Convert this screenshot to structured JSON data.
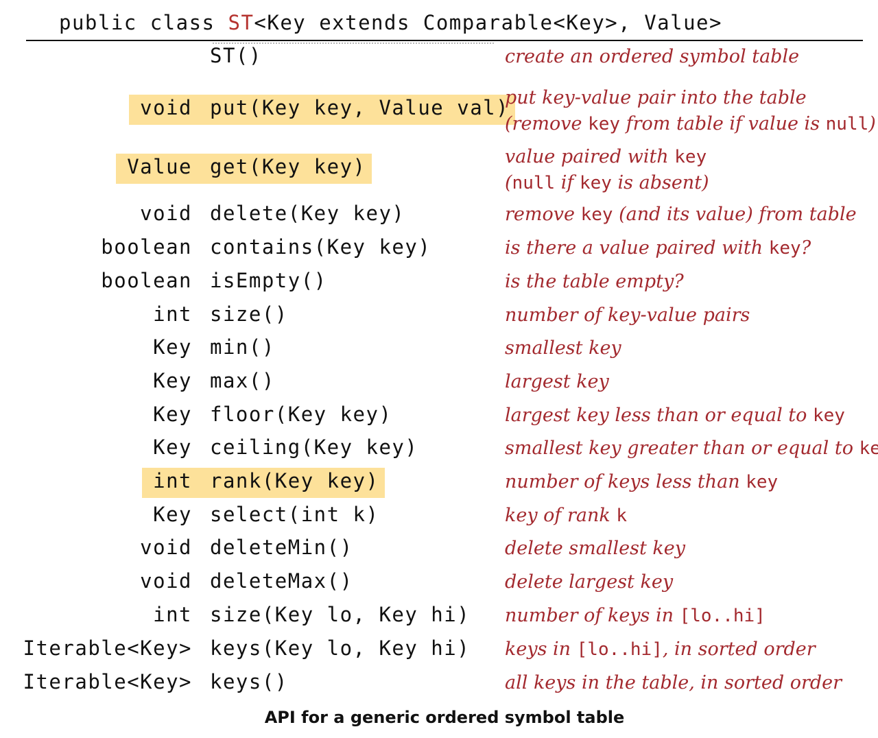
{
  "header": {
    "prefix": "public class ",
    "class_name": "ST",
    "generics": "<Key extends Comparable<Key>, Value>"
  },
  "rows": [
    {
      "ret": "",
      "sig": "ST()",
      "desc": [
        [
          "t",
          "create an ordered symbol table"
        ]
      ],
      "highlight": false
    },
    {
      "ret": "void",
      "sig": "put(Key key, Value val)",
      "desc": [
        [
          "t",
          "put key-value pair into the table"
        ],
        [
          "br",
          ""
        ],
        [
          "t",
          "(remove "
        ],
        [
          "c",
          "key"
        ],
        [
          "t",
          " from table if value is "
        ],
        [
          "c",
          "null"
        ],
        [
          "t",
          ")"
        ]
      ],
      "highlight": true
    },
    {
      "ret": "Value",
      "sig": "get(Key key)",
      "desc": [
        [
          "t",
          "value paired with "
        ],
        [
          "c",
          "key"
        ],
        [
          "br",
          ""
        ],
        [
          "t",
          "("
        ],
        [
          "c",
          "null"
        ],
        [
          "t",
          " if "
        ],
        [
          "c",
          "key"
        ],
        [
          "t",
          " is absent)"
        ]
      ],
      "highlight": true
    },
    {
      "ret": "void",
      "sig": "delete(Key key)",
      "desc": [
        [
          "t",
          "remove "
        ],
        [
          "c",
          "key"
        ],
        [
          "t",
          " (and its value) from table"
        ]
      ],
      "highlight": false
    },
    {
      "ret": "boolean",
      "sig": "contains(Key key)",
      "desc": [
        [
          "t",
          "is there a value paired with "
        ],
        [
          "c",
          "key"
        ],
        [
          "t",
          "?"
        ]
      ],
      "highlight": false
    },
    {
      "ret": "boolean",
      "sig": "isEmpty()",
      "desc": [
        [
          "t",
          "is the table empty?"
        ]
      ],
      "highlight": false
    },
    {
      "ret": "int",
      "sig": "size()",
      "desc": [
        [
          "t",
          "number of key-value pairs"
        ]
      ],
      "highlight": false
    },
    {
      "ret": "Key",
      "sig": "min()",
      "desc": [
        [
          "t",
          "smallest key"
        ]
      ],
      "highlight": false
    },
    {
      "ret": "Key",
      "sig": "max()",
      "desc": [
        [
          "t",
          "largest key"
        ]
      ],
      "highlight": false
    },
    {
      "ret": "Key",
      "sig": "floor(Key key)",
      "desc": [
        [
          "t",
          "largest key less than or equal to "
        ],
        [
          "c",
          "key"
        ]
      ],
      "highlight": false
    },
    {
      "ret": "Key",
      "sig": "ceiling(Key key)",
      "desc": [
        [
          "t",
          "smallest key greater than or equal to "
        ],
        [
          "c",
          "key"
        ]
      ],
      "highlight": false
    },
    {
      "ret": "int",
      "sig": "rank(Key key)",
      "desc": [
        [
          "t",
          "number of keys less than "
        ],
        [
          "c",
          "key"
        ]
      ],
      "highlight": true
    },
    {
      "ret": "Key",
      "sig": "select(int k)",
      "desc": [
        [
          "t",
          "key of rank "
        ],
        [
          "c",
          "k"
        ]
      ],
      "highlight": false
    },
    {
      "ret": "void",
      "sig": "deleteMin()",
      "desc": [
        [
          "t",
          "delete smallest key"
        ]
      ],
      "highlight": false
    },
    {
      "ret": "void",
      "sig": "deleteMax()",
      "desc": [
        [
          "t",
          "delete largest key"
        ]
      ],
      "highlight": false
    },
    {
      "ret": "int",
      "sig": "size(Key lo, Key hi)",
      "desc": [
        [
          "t",
          "number of keys in "
        ],
        [
          "c",
          "[lo..hi]"
        ]
      ],
      "highlight": false
    },
    {
      "ret": "Iterable<Key>",
      "sig": "keys(Key lo, Key hi)",
      "desc": [
        [
          "t",
          "keys in "
        ],
        [
          "c",
          "[lo..hi]"
        ],
        [
          "t",
          ", in sorted order"
        ]
      ],
      "highlight": false
    },
    {
      "ret": "Iterable<Key>",
      "sig": "keys()",
      "desc": [
        [
          "t",
          "all keys in the table, in sorted order"
        ]
      ],
      "highlight": false
    }
  ],
  "caption": "API for a generic ordered symbol table",
  "colors": {
    "description": "#a3292e",
    "highlight": "#fde19a",
    "class_name": "#b5322e"
  }
}
